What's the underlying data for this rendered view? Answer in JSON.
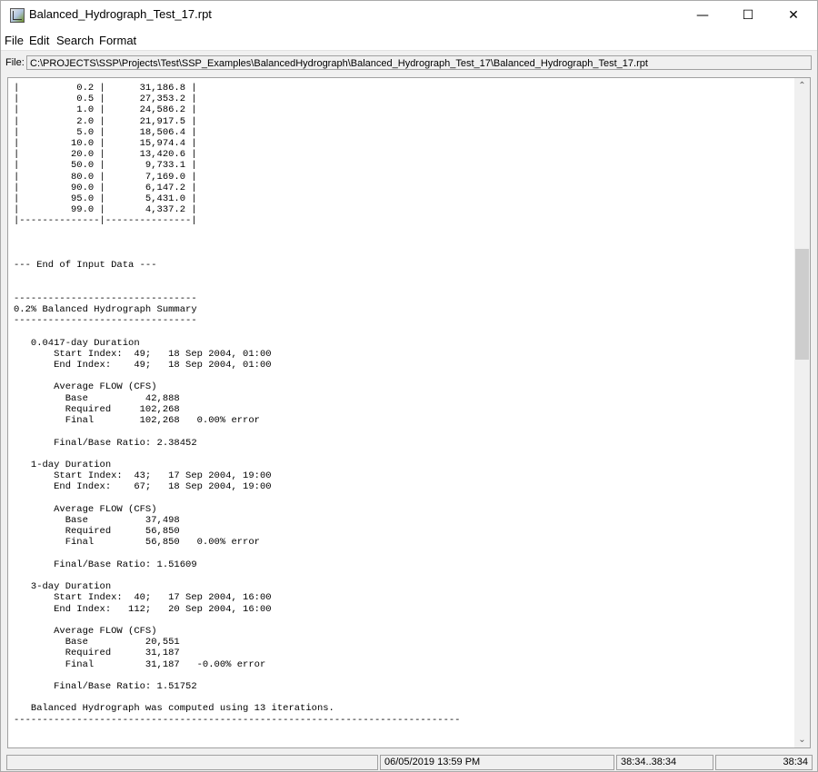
{
  "window": {
    "title": "Balanced_Hydrograph_Test_17.rpt",
    "controls": {
      "minimize": "—",
      "maximize": "☐",
      "close": "✕"
    }
  },
  "menu": [
    "File",
    "Edit",
    "Search",
    "Format"
  ],
  "file": {
    "label": "File:",
    "path": "C:\\PROJECTS\\SSP\\Projects\\Test\\SSP_Examples\\BalancedHydrograph\\Balanced_Hydrograph_Test_17\\Balanced_Hydrograph_Test_17.rpt"
  },
  "report_text": "|          0.2 |      31,186.8 |\n|          0.5 |      27,353.2 |\n|          1.0 |      24,586.2 |\n|          2.0 |      21,917.5 |\n|          5.0 |      18,506.4 |\n|         10.0 |      15,974.4 |\n|         20.0 |      13,420.6 |\n|         50.0 |       9,733.1 |\n|         80.0 |       7,169.0 |\n|         90.0 |       6,147.2 |\n|         95.0 |       5,431.0 |\n|         99.0 |       4,337.2 |\n|--------------|---------------|\n\n\n\n--- End of Input Data ---\n\n\n--------------------------------\n0.2% Balanced Hydrograph Summary\n--------------------------------\n\n   0.0417-day Duration\n       Start Index:  49;   18 Sep 2004, 01:00\n       End Index:    49;   18 Sep 2004, 01:00\n\n       Average FLOW (CFS)\n         Base          42,888\n         Required     102,268\n         Final        102,268   0.00% error\n\n       Final/Base Ratio: 2.38452\n\n   1-day Duration\n       Start Index:  43;   17 Sep 2004, 19:00\n       End Index:    67;   18 Sep 2004, 19:00\n\n       Average FLOW (CFS)\n         Base          37,498\n         Required      56,850\n         Final         56,850   0.00% error\n\n       Final/Base Ratio: 1.51609\n\n   3-day Duration\n       Start Index:  40;   17 Sep 2004, 16:00\n       End Index:   112;   20 Sep 2004, 16:00\n\n       Average FLOW (CFS)\n         Base          20,551\n         Required      31,187\n         Final         31,187   -0.00% error\n\n       Final/Base Ratio: 1.51752\n\n   Balanced Hydrograph was computed using 13 iterations.\n------------------------------------------------------------------------------\n\n\n--------------------------------",
  "scrollbar": {
    "up_arrow": "⌃",
    "down_arrow": "⌄"
  },
  "status": {
    "blank": "",
    "timestamp": "06/05/2019 13:59 PM",
    "range": "38:34..38:34",
    "position": "38:34"
  }
}
